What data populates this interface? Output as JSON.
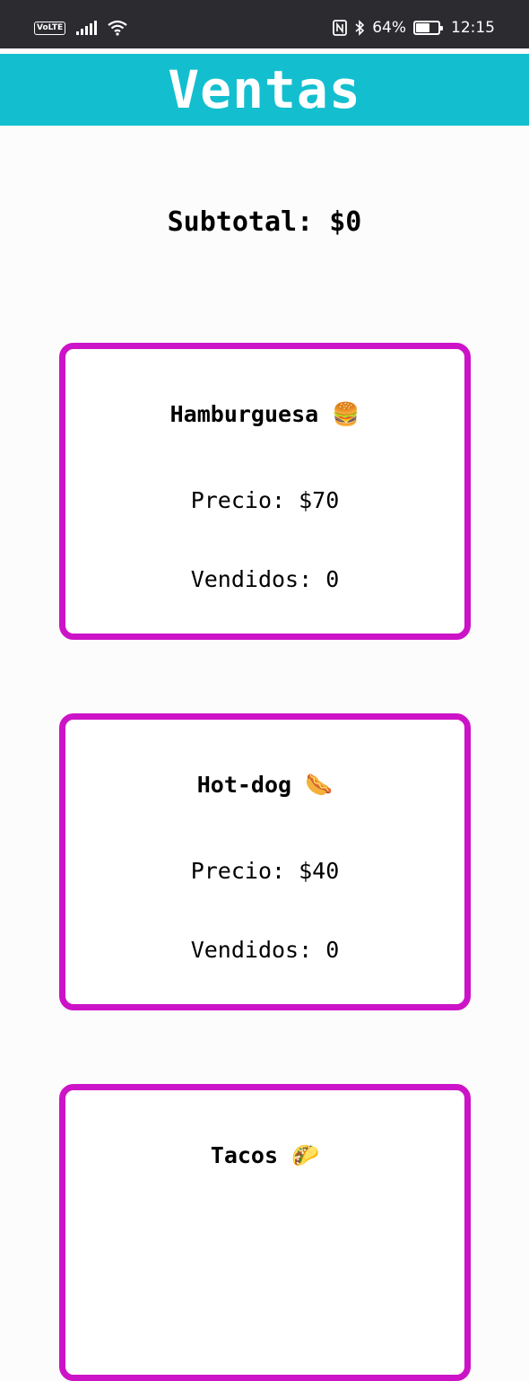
{
  "status_bar": {
    "volte": "VoLTE",
    "battery_percent": "64%",
    "battery_level": 0.64,
    "time": "12:15"
  },
  "app_bar": {
    "title": "Ventas"
  },
  "subtotal": "Subtotal: $0",
  "products": [
    {
      "name": "Hamburguesa",
      "emoji": "🍔",
      "price": "Precio: $70",
      "sold": "Vendidos: 0"
    },
    {
      "name": "Hot-dog",
      "emoji": "🌭",
      "price": "Precio: $40",
      "sold": "Vendidos: 0"
    },
    {
      "name": "Tacos",
      "emoji": "🌮",
      "price": "",
      "sold": ""
    }
  ],
  "colors": {
    "accent": "#13bfcf",
    "card_border": "#cc13c7",
    "status_bar": "#2b2b30"
  }
}
